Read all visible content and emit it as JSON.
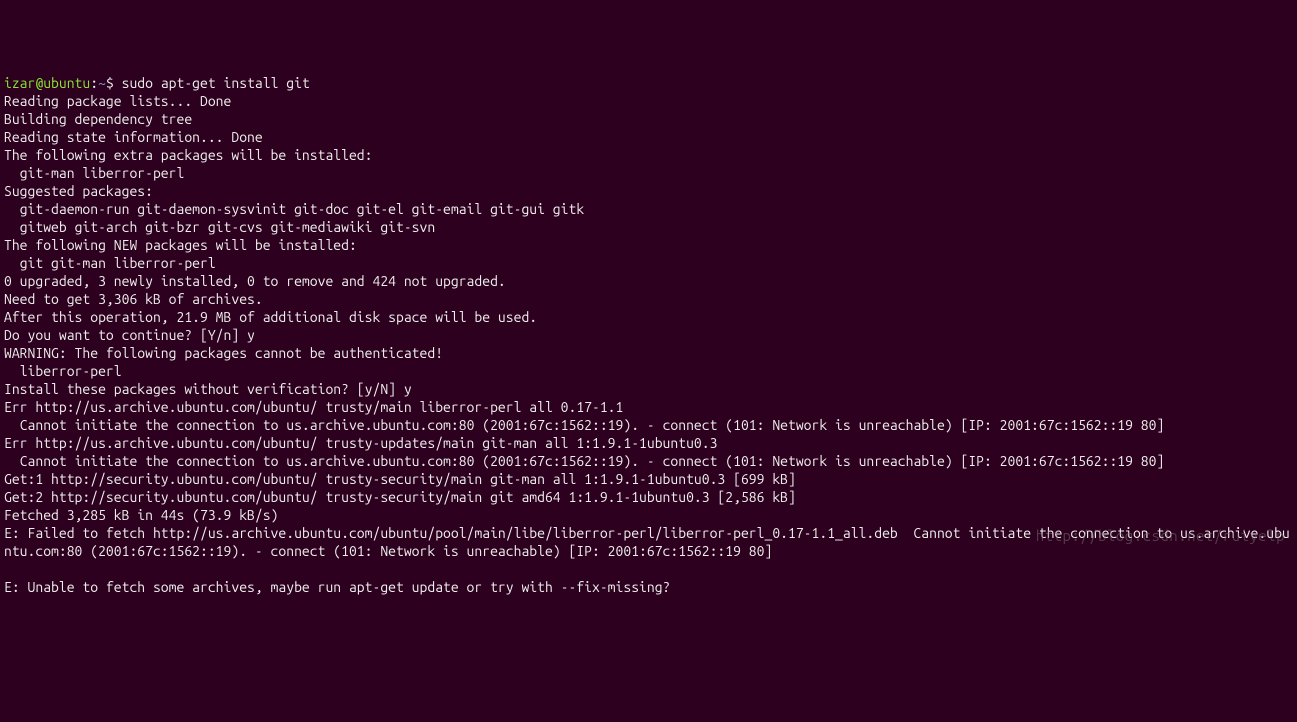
{
  "prompt": {
    "user_host": "izar@ubuntu",
    "separator": ":",
    "path": "~",
    "sigil": "$"
  },
  "command": "sudo apt-get install git",
  "lines": [
    "Reading package lists... Done",
    "Building dependency tree",
    "Reading state information... Done",
    "The following extra packages will be installed:",
    "  git-man liberror-perl",
    "Suggested packages:",
    "  git-daemon-run git-daemon-sysvinit git-doc git-el git-email git-gui gitk",
    "  gitweb git-arch git-bzr git-cvs git-mediawiki git-svn",
    "The following NEW packages will be installed:",
    "  git git-man liberror-perl",
    "0 upgraded, 3 newly installed, 0 to remove and 424 not upgraded.",
    "Need to get 3,306 kB of archives.",
    "After this operation, 21.9 MB of additional disk space will be used.",
    "Do you want to continue? [Y/n] y",
    "WARNING: The following packages cannot be authenticated!",
    "  liberror-perl",
    "Install these packages without verification? [y/N] y",
    "Err http://us.archive.ubuntu.com/ubuntu/ trusty/main liberror-perl all 0.17-1.1",
    "  Cannot initiate the connection to us.archive.ubuntu.com:80 (2001:67c:1562::19). - connect (101: Network is unreachable) [IP: 2001:67c:1562::19 80]",
    "Err http://us.archive.ubuntu.com/ubuntu/ trusty-updates/main git-man all 1:1.9.1-1ubuntu0.3",
    "  Cannot initiate the connection to us.archive.ubuntu.com:80 (2001:67c:1562::19). - connect (101: Network is unreachable) [IP: 2001:67c:1562::19 80]",
    "Get:1 http://security.ubuntu.com/ubuntu/ trusty-security/main git-man all 1:1.9.1-1ubuntu0.3 [699 kB]",
    "Get:2 http://security.ubuntu.com/ubuntu/ trusty-security/main git amd64 1:1.9.1-1ubuntu0.3 [2,586 kB]",
    "Fetched 3,285 kB in 44s (73.9 kB/s)",
    "E: Failed to fetch http://us.archive.ubuntu.com/ubuntu/pool/main/libe/liberror-perl/liberror-perl_0.17-1.1_all.deb  Cannot initiate the connection to us.archive.ubuntu.com:80 (2001:67c:1562::19). - connect (101: Network is unreachable) [IP: 2001:67c:1562::19 80]",
    "",
    "E: Unable to fetch some archives, maybe run apt-get update or try with --fix-missing?"
  ],
  "watermark": "http://blog.csdn.net/ruiyelp"
}
